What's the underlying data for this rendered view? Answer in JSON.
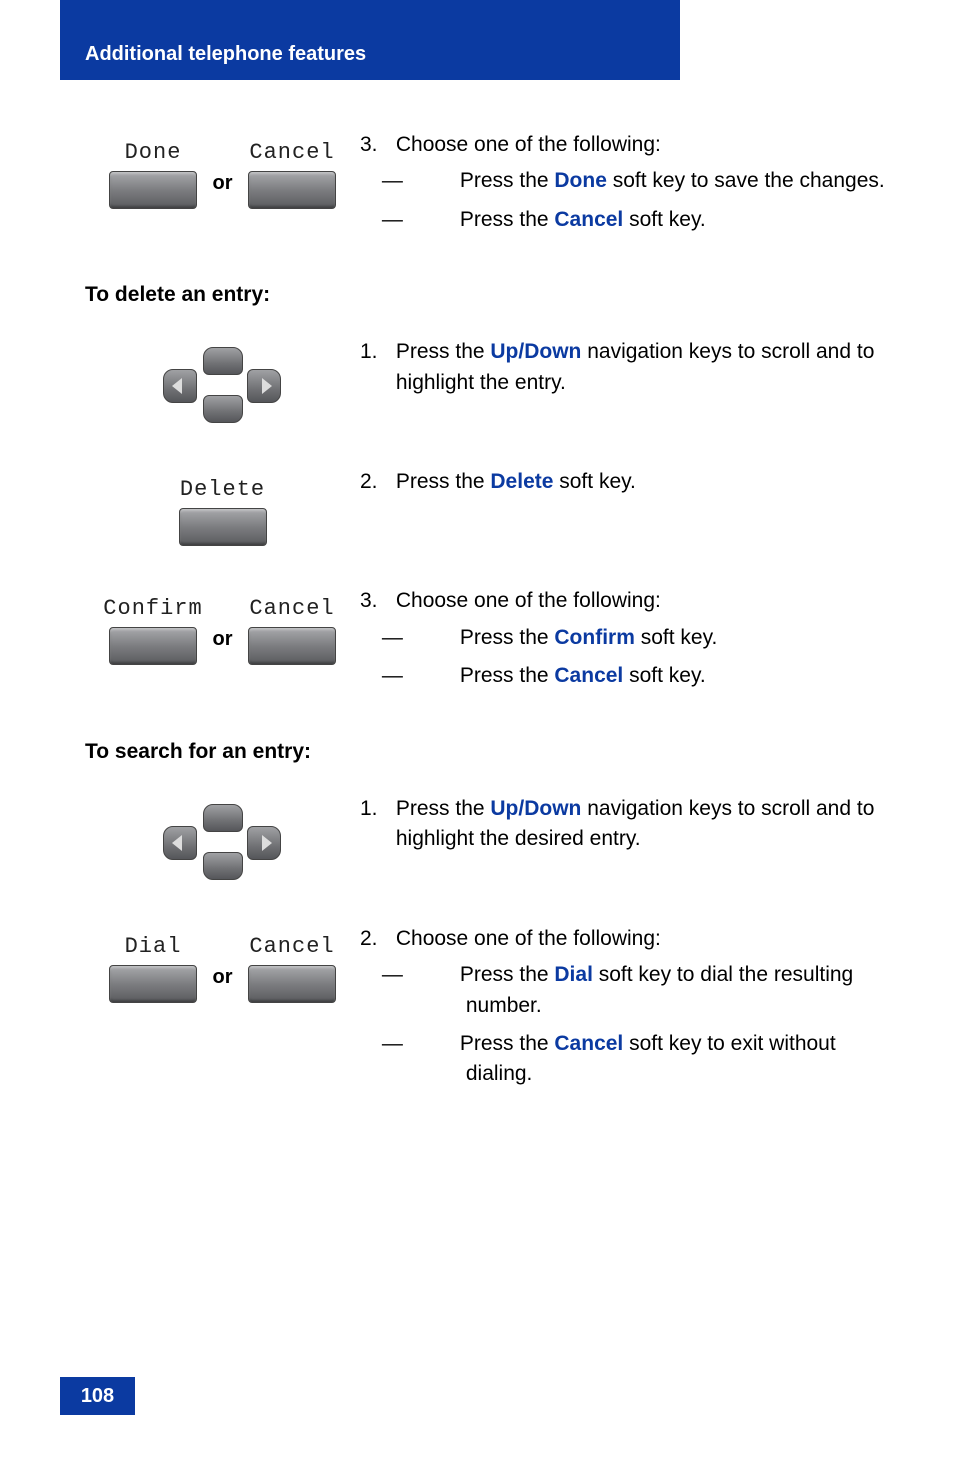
{
  "header": {
    "title": "Additional telephone features"
  },
  "softkeys": {
    "done": "Done",
    "cancel": "Cancel",
    "delete": "Delete",
    "confirm": "Confirm",
    "dial": "Dial",
    "or": "or"
  },
  "step_block1": {
    "num": "3.",
    "intro": "Choose one of the following:",
    "items": [
      {
        "pre": "Press the ",
        "hl": "Done",
        "post": " soft key to save the changes."
      },
      {
        "pre": "Press the ",
        "hl": "Cancel",
        "post": " soft key."
      }
    ]
  },
  "section_delete": {
    "title": "To delete an entry:"
  },
  "delete_step1": {
    "num": "1.",
    "pre": "Press the ",
    "hl": "Up/Down",
    "post": " navigation keys to scroll and to highlight the entry."
  },
  "delete_step2": {
    "num": "2.",
    "pre": "Press the ",
    "hl": "Delete",
    "post": " soft key."
  },
  "delete_step3": {
    "num": "3.",
    "intro": "Choose one of the following:",
    "items": [
      {
        "pre": "Press the ",
        "hl": "Confirm",
        "post": " soft key."
      },
      {
        "pre": "Press the ",
        "hl": "Cancel",
        "post": " soft key."
      }
    ]
  },
  "section_search": {
    "title": "To search for an entry:"
  },
  "search_step1": {
    "num": "1.",
    "pre": "Press the ",
    "hl": "Up/Down",
    "post": " navigation keys to scroll and to highlight the desired entry."
  },
  "search_step2": {
    "num": "2.",
    "intro": "Choose one of the following:",
    "items": [
      {
        "pre": "Press the ",
        "hl": "Dial",
        "post": " soft key to dial the resulting number."
      },
      {
        "pre": "Press the ",
        "hl": "Cancel",
        "post": " soft key to exit without dialing."
      }
    ]
  },
  "page_number": "108"
}
